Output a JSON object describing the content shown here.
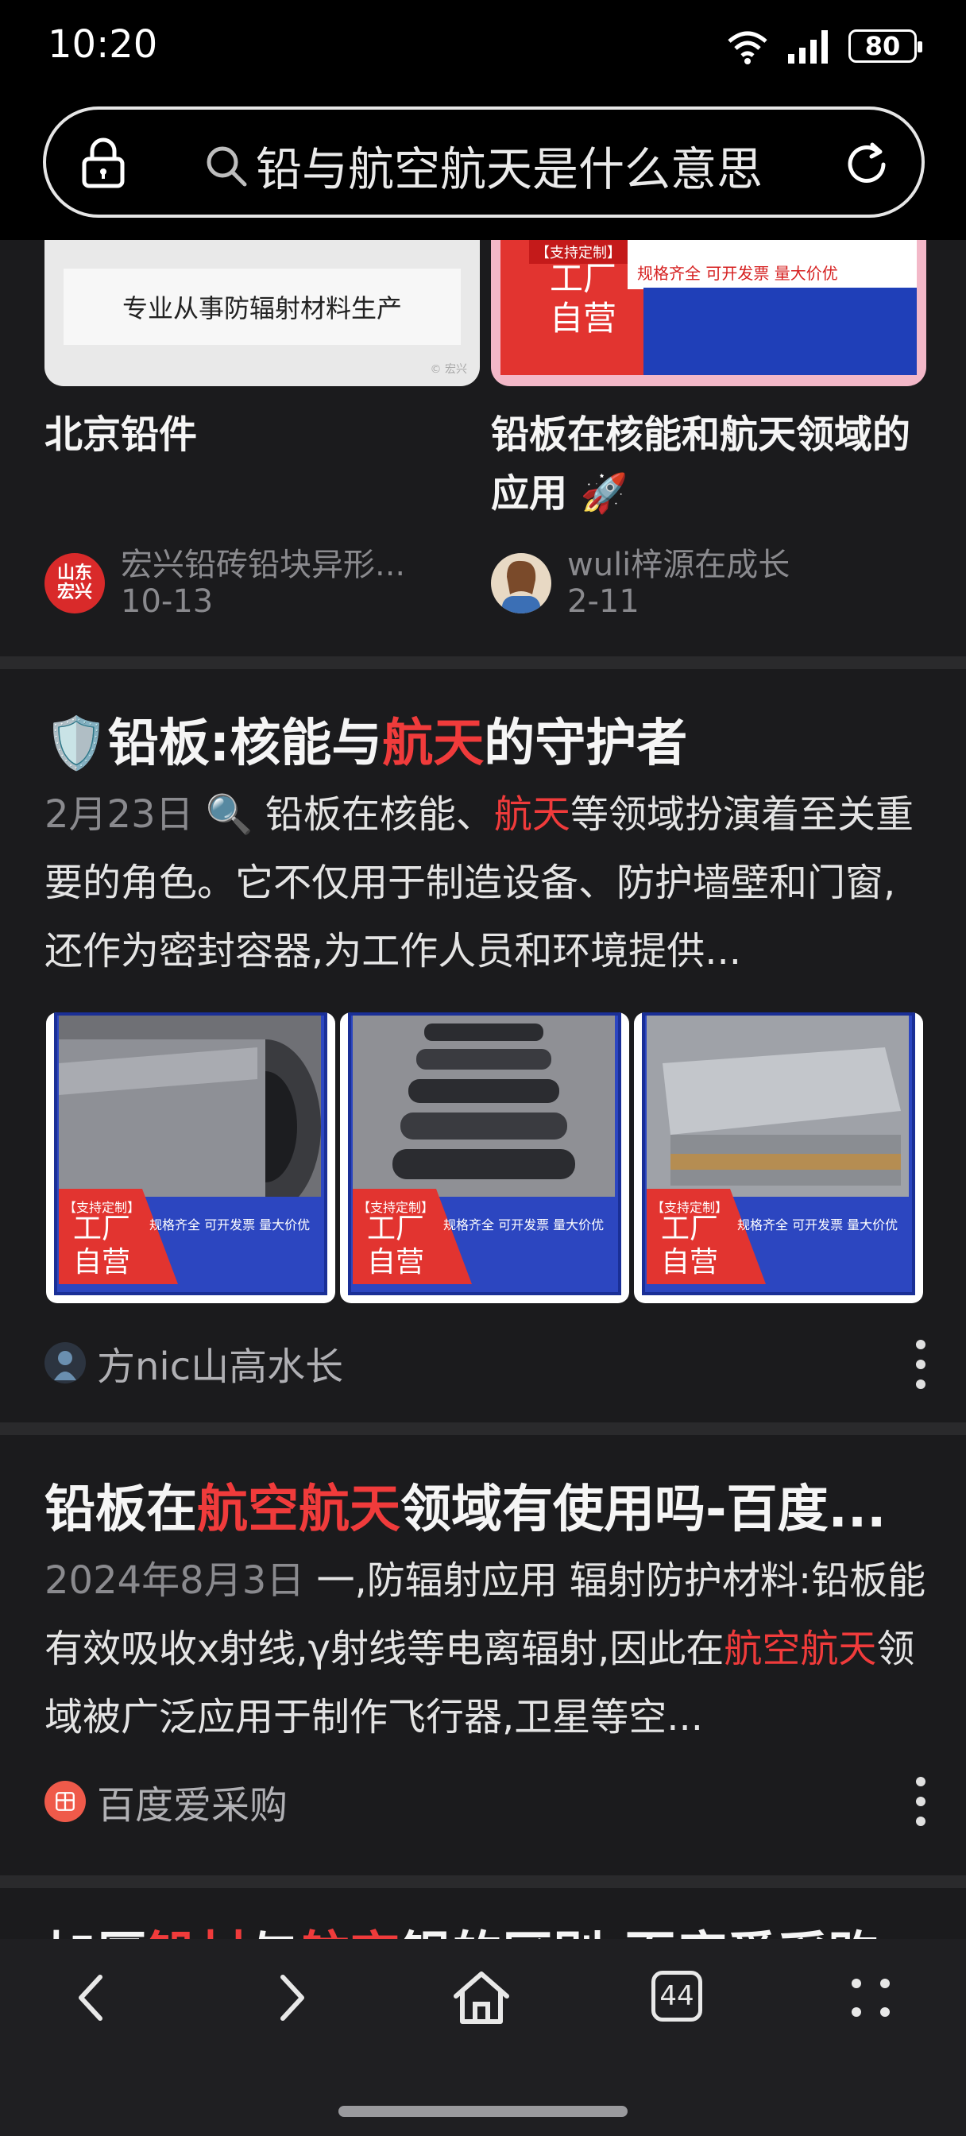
{
  "status_bar": {
    "time": "10:20",
    "battery": "80"
  },
  "search": {
    "query": "铅与航空航天是什么意思"
  },
  "grid": {
    "left": {
      "caption": "专业从事防辐射材料生产",
      "title": "北京铅件",
      "author": "宏兴铅砖铅块异形...",
      "date": "10-13",
      "avatar_text": "山东宏兴"
    },
    "right": {
      "badge_top": "【支持定制】",
      "badge_big": "工厂自营",
      "spec": "规格齐全 可开发票 量大价优",
      "title": "铅板在核能和航天领域的应用 🚀",
      "author": "wuli梓源在成长",
      "date": "2-11"
    }
  },
  "result1": {
    "icon": "🛡️",
    "title_a": "铅板:核能与",
    "title_hl": "航天",
    "title_b": "的守护者",
    "date": "2月23日",
    "snippet_a": " 🔍 铅板在核能、",
    "snippet_hl": "航天",
    "snippet_b": "等领域扮演着至关重要的角色。它不仅用于制造设备、防护墙壁和门窗,还作为密封容器,为工作人员和环境提供...",
    "tile_badge": "【支持定制】",
    "tile_big": "工厂自营",
    "tile_spec": "规格齐全 可开发票 量大价优",
    "source": "方nic山高水长"
  },
  "result2": {
    "title_a": "铅板在",
    "title_hl": "航空航天",
    "title_b": "领域有使用吗-百度...",
    "date": "2024年8月3日",
    "snippet_a": " 一,防辐射应用 辐射防护材料:铅板能有效吸收x射线,γ射线等电离辐射,因此在",
    "snippet_hl": "航空航天",
    "snippet_b": "领域被广泛应用于制作飞行器,卫星等空...",
    "source": "百度爱采购"
  },
  "result3": {
    "title_a": "加厚",
    "title_hl1": "铅材",
    "title_b": "与",
    "title_hl2": "航空",
    "title_c": "铝的区别-百度爱采购"
  },
  "bottom_nav": {
    "tabs_count": "44"
  },
  "colors": {
    "highlight": "#f03b3b",
    "background": "#1b1b1d",
    "header": "#000000"
  }
}
